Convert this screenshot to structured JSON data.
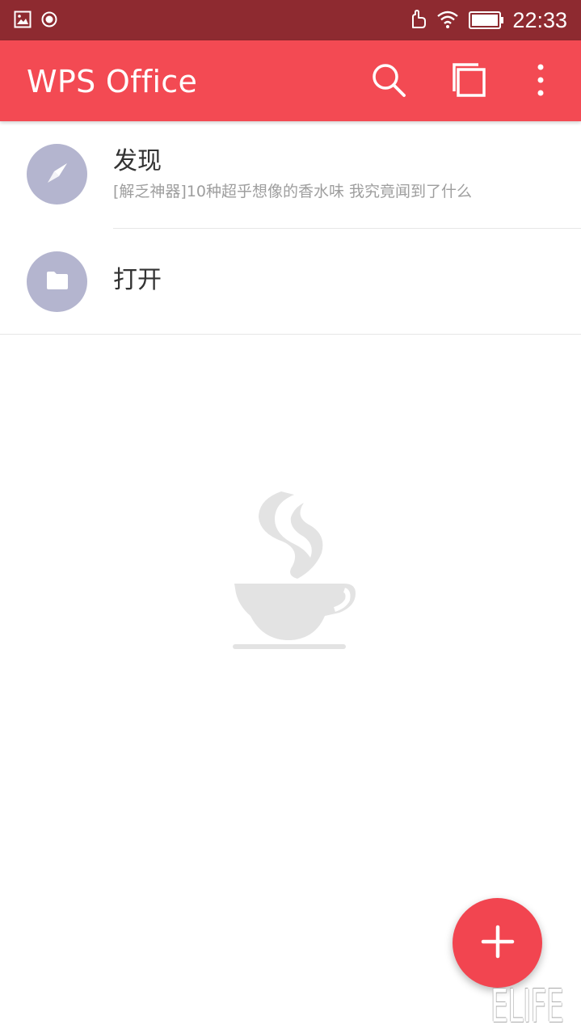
{
  "status_bar": {
    "time": "22:33",
    "icons": [
      "gallery-icon",
      "record-icon",
      "hand-icon",
      "wifi-icon",
      "battery-icon"
    ]
  },
  "app_bar": {
    "title": "WPS Office",
    "actions": [
      "search-icon",
      "multi-window-icon",
      "more-vert-icon"
    ],
    "color": "#f34a53"
  },
  "list": {
    "items": [
      {
        "title": "发现",
        "subtitle": "[解乏神器]10种超乎想像的香水味 我究竟闻到了什么",
        "icon": "compass-icon"
      },
      {
        "title": "打开",
        "icon": "folder-icon"
      }
    ]
  },
  "empty_state": {
    "icon": "coffee-cup-icon"
  },
  "fab": {
    "icon": "plus-icon",
    "color": "#f24550"
  },
  "watermark": {
    "text": "ELIFE"
  }
}
